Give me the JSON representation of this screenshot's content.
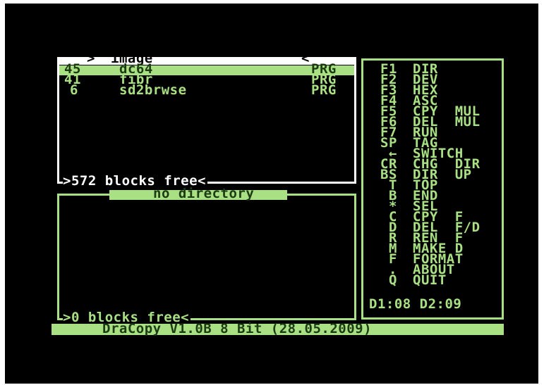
{
  "colors": {
    "bg": "#000000",
    "green": "#a8e083",
    "white": "#ffffff",
    "dark": "#1c3a14"
  },
  "top_panel": {
    "title": "image",
    "left_arrow": ">",
    "right_arrow": "<",
    "files": [
      {
        "blocks": "45",
        "name": "dc64",
        "type": "PRG",
        "selected": true
      },
      {
        "blocks": "41",
        "name": "fibr",
        "type": "PRG",
        "selected": false
      },
      {
        "blocks": "6",
        "name": "sd2brwse",
        "type": "PRG",
        "selected": false
      }
    ],
    "footer": ">572 blocks free<"
  },
  "bottom_panel": {
    "title": "no directory",
    "footer": ">0 blocks free<"
  },
  "commands": [
    {
      "key": "F1",
      "label": "DIR"
    },
    {
      "key": "F2",
      "label": "DEV"
    },
    {
      "key": "F3",
      "label": "HEX"
    },
    {
      "key": "F4",
      "label": "ASC"
    },
    {
      "key": "F5",
      "label": "CPY  MUL"
    },
    {
      "key": "F6",
      "label": "DEL  MUL"
    },
    {
      "key": "F7",
      "label": "RUN"
    },
    {
      "key": "SP",
      "label": "TAG"
    },
    {
      "key": " ←",
      "label": "SWITCH"
    },
    {
      "key": "CR",
      "label": "CHG  DIR"
    },
    {
      "key": "BS",
      "label": "DIR  UP"
    },
    {
      "key": " T",
      "label": "TOP"
    },
    {
      "key": " B",
      "label": "END"
    },
    {
      "key": " *",
      "label": "SEL"
    },
    {
      "key": " C",
      "label": "CPY  F"
    },
    {
      "key": " D",
      "label": "DEL  F/D"
    },
    {
      "key": " R",
      "label": "REN  F"
    },
    {
      "key": " M",
      "label": "MAKE D"
    },
    {
      "key": " F",
      "label": "FORMAT"
    },
    {
      "key": " .",
      "label": "ABOUT"
    },
    {
      "key": " Q",
      "label": "QUIT"
    }
  ],
  "drives": "D1:08 D2:09",
  "status_bar": "DraCopy V1.0B 8 Bit (28.05.2009)"
}
